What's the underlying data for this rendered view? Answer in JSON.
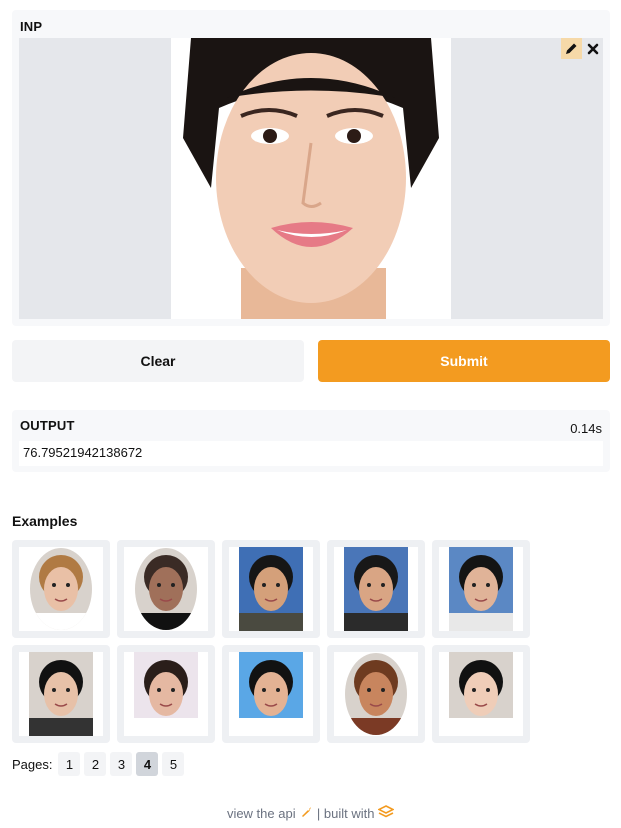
{
  "input": {
    "label": "INP"
  },
  "buttons": {
    "clear": "Clear",
    "submit": "Submit"
  },
  "output": {
    "label": "OUTPUT",
    "timing": "0.14s",
    "value": "76.79521942138672"
  },
  "examples": {
    "title": "Examples",
    "items": [
      {
        "name": "example-1",
        "bg": "#ffffff",
        "shape": "oval",
        "skin": "#e9c0a6",
        "hair": "#b07a43",
        "shirt": "#ffffff"
      },
      {
        "name": "example-2",
        "bg": "#ffffff",
        "shape": "oval",
        "skin": "#a0705a",
        "hair": "#3a2b25",
        "shirt": "#111111"
      },
      {
        "name": "example-3",
        "bg": "#3f6fb5",
        "shape": "rect",
        "skin": "#d4a07a",
        "hair": "#161616",
        "shirt": "#4a4a40"
      },
      {
        "name": "example-4",
        "bg": "#4a76b8",
        "shape": "rect",
        "skin": "#d9a584",
        "hair": "#181818",
        "shirt": "#2b2b2b"
      },
      {
        "name": "example-5",
        "bg": "#5b88c4",
        "shape": "rect",
        "skin": "#e0b398",
        "hair": "#141414",
        "shirt": "#e8e8e8"
      },
      {
        "name": "example-6",
        "bg": "#ffffff",
        "shape": "rect",
        "skin": "#e7c1a8",
        "hair": "#111111",
        "shirt": "#333333"
      },
      {
        "name": "example-7",
        "bg": "#ece4ec",
        "shape": "rect",
        "skin": "#e5b8a2",
        "hair": "#2a1e1a",
        "shirt": "#ffffff"
      },
      {
        "name": "example-8",
        "bg": "#5aa7e6",
        "shape": "rect",
        "skin": "#e3b294",
        "hair": "#121212",
        "shirt": "#ffffff"
      },
      {
        "name": "example-9",
        "bg": "#ffffff",
        "shape": "oval",
        "skin": "#c8855e",
        "hair": "#6e3b20",
        "shirt": "#7b3a25"
      },
      {
        "name": "example-10",
        "bg": "#ffffff",
        "shape": "rect",
        "skin": "#efcdb8",
        "hair": "#111111",
        "shirt": "#ffffff"
      }
    ]
  },
  "pagination": {
    "label": "Pages:",
    "pages": [
      "1",
      "2",
      "3",
      "4",
      "5"
    ],
    "active": "4"
  },
  "footer": {
    "api_text": "view the api",
    "separator": "|",
    "built_text": "built with"
  },
  "colors": {
    "accent": "#f39b20",
    "panel": "#f7f8fa",
    "placeholder": "#e5e7eb"
  },
  "icons": {
    "edit": "pencil-icon",
    "close": "close-icon",
    "api": "rocket-icon",
    "logo": "gradio-logo-icon"
  }
}
